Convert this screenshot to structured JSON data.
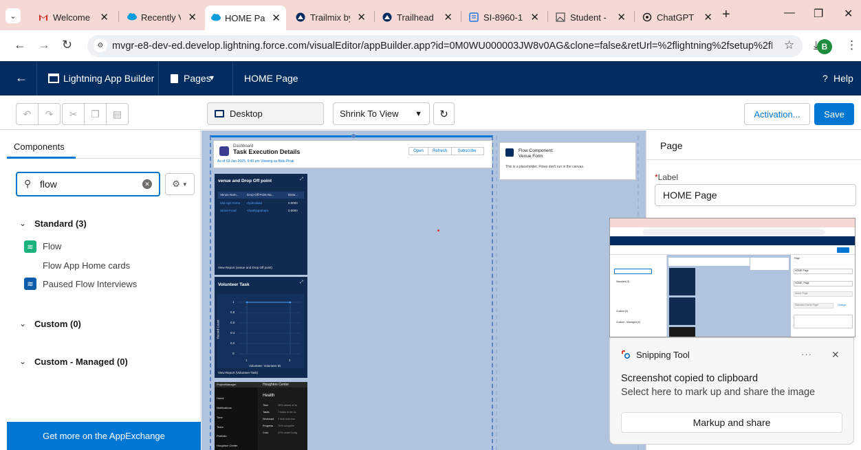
{
  "browser": {
    "tabs": [
      {
        "label": "Welcome t",
        "icon": "gmail-icon"
      },
      {
        "label": "Recently Vi",
        "icon": "salesforce-cloud-icon"
      },
      {
        "label": "HOME Pag",
        "icon": "salesforce-cloud-icon",
        "active": true
      },
      {
        "label": "Trailmix by",
        "icon": "trailhead-icon"
      },
      {
        "label": "Trailhead |",
        "icon": "trailhead-icon"
      },
      {
        "label": "SI-8960-1",
        "icon": "document-icon"
      },
      {
        "label": "Student -",
        "icon": "image-icon"
      },
      {
        "label": "ChatGPT",
        "icon": "chatgpt-icon"
      }
    ],
    "url": "mvgr-e8-dev-ed.develop.lightning.force.com/visualEditor/appBuilder.app?id=0M0WU000003JW8v0AG&clone=false&retUrl=%2flightning%2fsetup%2fFle...",
    "profile_initial": "B",
    "colors": {
      "tabbar": "#f6d9d5"
    }
  },
  "header": {
    "app_title": "Lightning App Builder",
    "pages_menu": "Pages",
    "page_name": "HOME Page",
    "help": "Help"
  },
  "toolbar": {
    "device": "Desktop",
    "view": "Shrink To View",
    "activation": "Activation...",
    "save": "Save"
  },
  "components": {
    "title": "Components",
    "search_value": "flow",
    "sections": [
      {
        "label": "Standard (3)",
        "items": [
          "Flow",
          "Flow App Home cards",
          "Paused Flow Interviews"
        ]
      },
      {
        "label": "Custom (0)",
        "items": []
      },
      {
        "label": "Custom - Managed (0)",
        "items": []
      }
    ],
    "appexchange": "Get more on the AppExchange"
  },
  "canvas": {
    "dashboard": {
      "eyebrow": "Dashboard",
      "title": "Task Execution Details",
      "meta": "As of 03-Jan-2025, 9:40 pm Viewing as Balu Pirati",
      "buttons": [
        "Open",
        "Refresh",
        "Subscribe"
      ]
    },
    "flow_component": {
      "title": "Flow Component:",
      "subtitle": "Venue Form",
      "note": "This is a placeholder. Flows don't run in the canvas."
    },
    "report1": {
      "title": "venue and Drop Off point",
      "columns": [
        "Venue Nam...",
        "Drop-Off Point Na...",
        "Dista..."
      ],
      "rows": [
        [
          "Old Age Home",
          "Hyderabad",
          "0.0000"
        ],
        [
          "Street Food",
          "Visakhapatnam",
          "0.0000"
        ]
      ],
      "footer": "View Report (venue and Drop Off point)"
    },
    "report2": {
      "title": "Volunteer Task",
      "ylabel": "Record Count",
      "xlabel": "Volunteer: Volunteer ID",
      "yticks": [
        "1",
        "0.8",
        "0.6",
        "0.4",
        "0.2",
        "0"
      ],
      "xticks": [
        "1",
        "2"
      ],
      "footer": "View Report (Volunteer Task)"
    },
    "pm": {
      "app": "ProjectManager",
      "center": "Houghton Center",
      "nav": [
        "Home",
        "Notifications",
        "Time",
        "Team",
        "Portfolio",
        "Houghton Center"
      ],
      "section": "Health",
      "rows": [
        [
          "Time",
          "28% ahead of sc"
        ],
        [
          "Tasks",
          "7 tasks to be co"
        ],
        [
          "Workload",
          "1 task overdue"
        ],
        [
          "Progress",
          "76% complete"
        ],
        [
          "Cost",
          "27% under budg"
        ]
      ]
    }
  },
  "properties": {
    "title": "Page",
    "label_caption": "Label",
    "label_value": "HOME Page"
  },
  "toast": {
    "app": "Snipping Tool",
    "title": "Screenshot copied to clipboard",
    "body": "Select here to mark up and share the image",
    "action": "Markup and share",
    "more": "···"
  },
  "thumbnail": {
    "page_label": "Page",
    "label_value": "HOME Page",
    "api_value": "HOME_Page",
    "type_value": "Home Page",
    "template_value": "Standard Home Page",
    "change": "Change",
    "sections": [
      "Standard (3)",
      "Custom (0)",
      "Custom - Managed (0)"
    ]
  }
}
